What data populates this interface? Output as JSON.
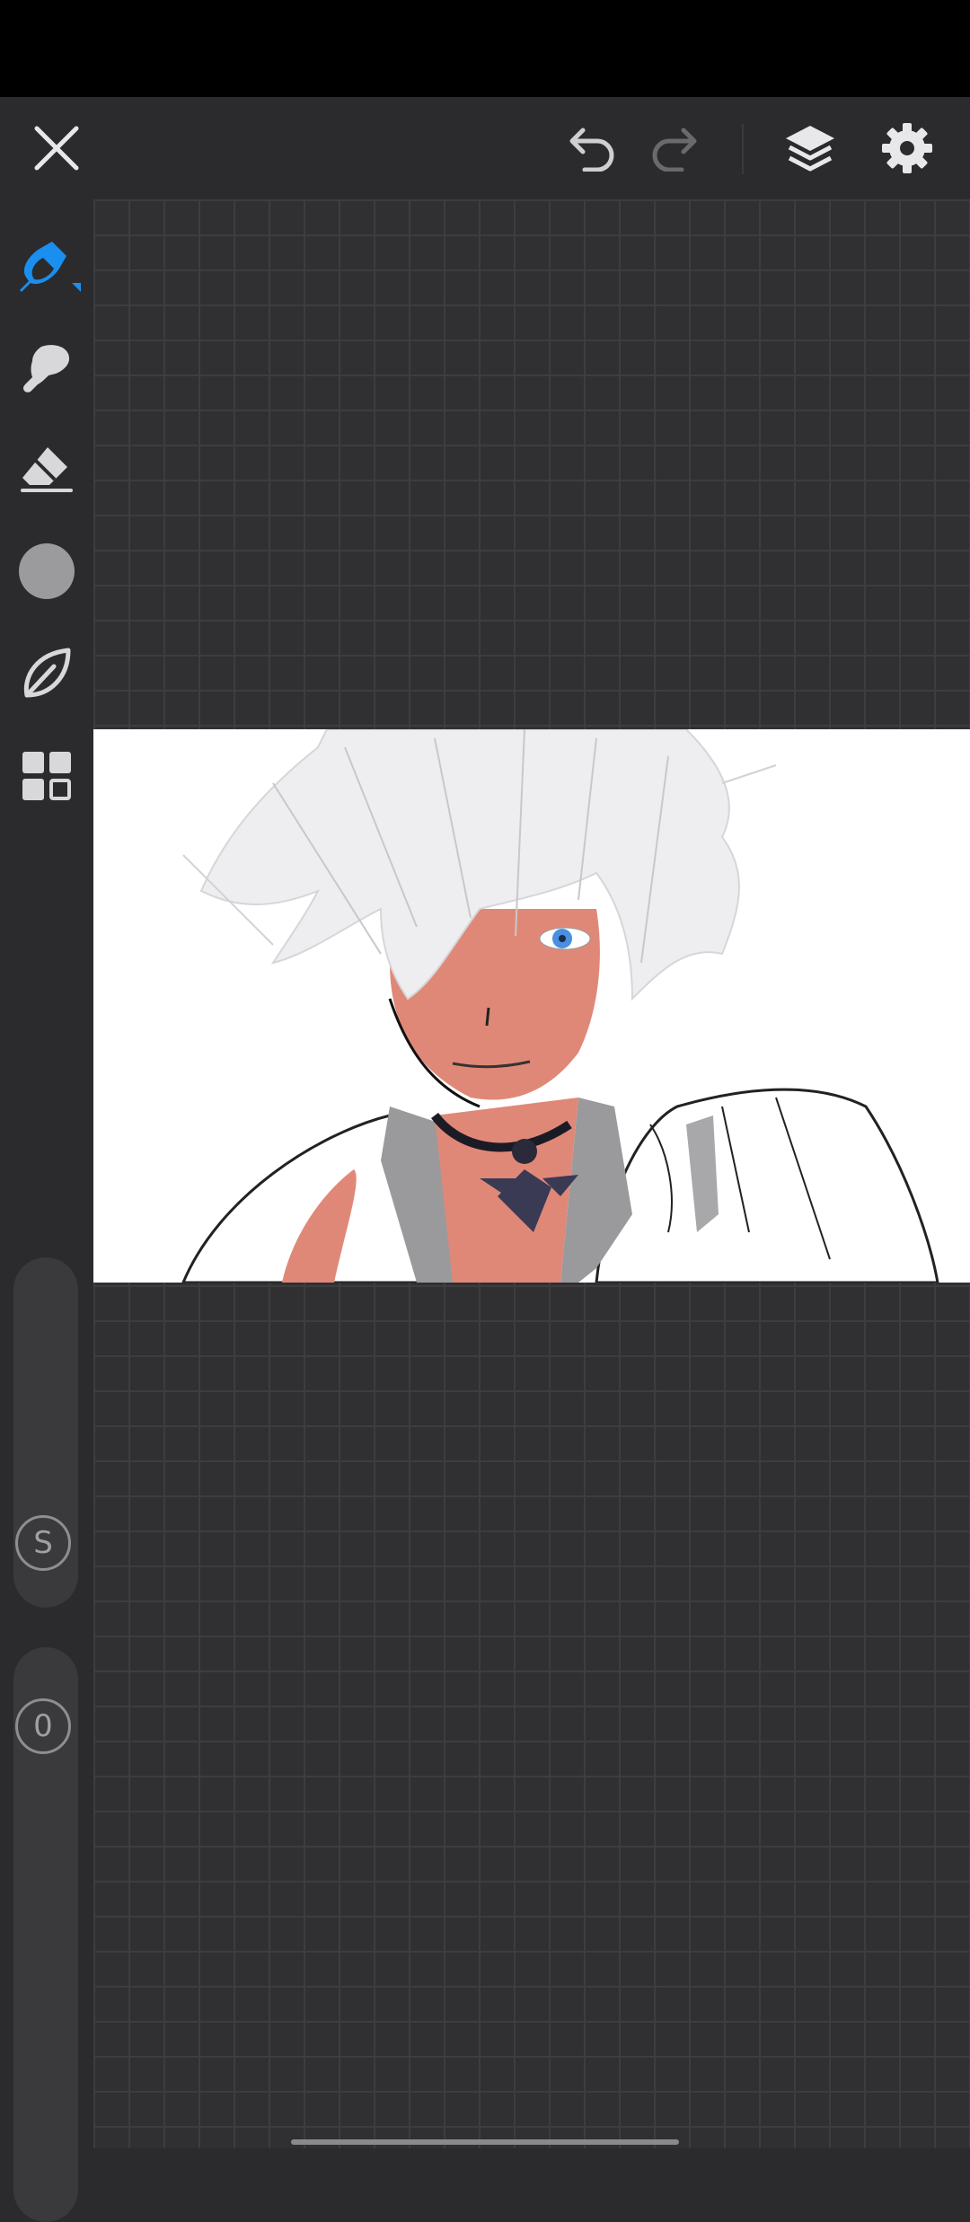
{
  "status_bar": {},
  "toolbar": {
    "icons": [
      "close-icon",
      "undo-icon",
      "redo-icon",
      "layers-icon",
      "settings-icon"
    ],
    "redo_enabled": false
  },
  "sidebar": {
    "tools": [
      "pen-tool-icon",
      "smudge-brush-icon",
      "eraser-icon",
      "color-picker-icon",
      "brush-leaf-icon",
      "gallery-grid-icon"
    ],
    "selected_tool": "pen-tool-icon",
    "size_slider": {
      "knob_label": "S"
    },
    "opacity_slider": {
      "knob_label": "0"
    }
  },
  "colors": {
    "accent": "#1a8ff0",
    "background": "#2b2b2d",
    "canvas_grid": "#303032",
    "current_color": "#9b9b9e"
  }
}
